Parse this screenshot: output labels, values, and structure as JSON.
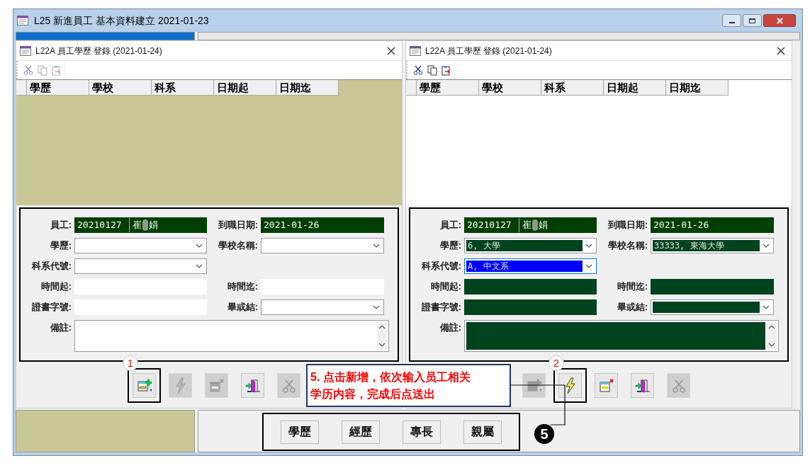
{
  "main_window": {
    "title": "L25 新進員工 基本資料建立  2021-01-23"
  },
  "dialogs": [
    {
      "title": "L22A 員工學歷 登錄 (2021-01-24)",
      "toolbar_enabled": false,
      "grid_active": false,
      "editing": false,
      "grid_columns": [
        "學歷",
        "學校",
        "科系",
        "日期起",
        "日期迄"
      ],
      "rows": [
        {
          "fields": [
            {
              "label": "員工:",
              "kind": "employee",
              "readonly": true,
              "focused": false,
              "values": [
                "20210127",
                "崔",
                "娟"
              ]
            },
            {
              "label": "到職日期:",
              "kind": "text",
              "readonly": true,
              "focused": false,
              "value": "2021-01-26"
            }
          ]
        },
        {
          "fields": [
            {
              "label": "學歷:",
              "kind": "combo",
              "readonly": false,
              "focused": false
            },
            {
              "label": "學校名稱:",
              "kind": "combo",
              "readonly": false,
              "focused": false
            }
          ]
        },
        {
          "fields": [
            {
              "label": "科系代號:",
              "kind": "combo",
              "readonly": false,
              "focused": false
            }
          ]
        },
        {
          "fields": [
            {
              "label": "時間起:",
              "kind": "text",
              "readonly": false,
              "focused": false
            },
            {
              "label": "時間迄:",
              "kind": "text",
              "readonly": false,
              "focused": false
            }
          ]
        },
        {
          "fields": [
            {
              "label": "證書字號:",
              "kind": "text",
              "readonly": false,
              "focused": false
            },
            {
              "label": "畢或結:",
              "kind": "combo",
              "readonly": false,
              "focused": false
            }
          ]
        },
        {
          "fields": [
            {
              "label": "備註:",
              "kind": "memo",
              "readonly": false,
              "focused": false
            }
          ]
        }
      ],
      "buttons": [
        {
          "kind": "add",
          "disabled": false,
          "marker": "1"
        },
        {
          "kind": "send",
          "disabled": true
        },
        {
          "kind": "delete",
          "disabled": true
        },
        {
          "kind": "exit",
          "disabled": false
        },
        {
          "kind": "cut",
          "disabled": true
        }
      ]
    },
    {
      "title": "L22A 員工學歷 登錄 (2021-01-24)",
      "toolbar_enabled": true,
      "grid_active": true,
      "editing": true,
      "grid_columns": [
        "學歷",
        "學校",
        "科系",
        "日期起",
        "日期迄"
      ],
      "rows": [
        {
          "fields": [
            {
              "label": "員工:",
              "kind": "employee",
              "readonly": true,
              "focused": false,
              "values": [
                "20210127",
                "崔",
                "娟"
              ]
            },
            {
              "label": "到職日期:",
              "kind": "text",
              "readonly": true,
              "focused": false,
              "value": "2021-01-26"
            }
          ]
        },
        {
          "fields": [
            {
              "label": "學歷:",
              "kind": "combo",
              "readonly": false,
              "focused": false,
              "value": "6, 大學"
            },
            {
              "label": "學校名稱:",
              "kind": "combo",
              "readonly": false,
              "focused": false,
              "value": "33333, 東海大學"
            }
          ]
        },
        {
          "fields": [
            {
              "label": "科系代號:",
              "kind": "combo",
              "readonly": false,
              "focused": true,
              "value": "A, 中文系"
            }
          ]
        },
        {
          "fields": [
            {
              "label": "時間起:",
              "kind": "text",
              "readonly": false,
              "focused": false
            },
            {
              "label": "時間迄:",
              "kind": "text",
              "readonly": false,
              "focused": false
            }
          ]
        },
        {
          "fields": [
            {
              "label": "證書字號:",
              "kind": "text",
              "readonly": false,
              "focused": false
            },
            {
              "label": "畢或結:",
              "kind": "combo",
              "readonly": false,
              "focused": false
            }
          ]
        },
        {
          "fields": [
            {
              "label": "備註:",
              "kind": "memo",
              "readonly": false,
              "focused": false
            }
          ]
        }
      ],
      "buttons": [
        {
          "kind": "add",
          "disabled": true
        },
        {
          "kind": "send",
          "disabled": false,
          "marker": "2"
        },
        {
          "kind": "delete",
          "disabled": false
        },
        {
          "kind": "exit",
          "disabled": false
        },
        {
          "kind": "cut",
          "disabled": true
        }
      ]
    }
  ],
  "bottom_tabs": [
    {
      "label": "學歷",
      "selected": false
    },
    {
      "label": "經歷",
      "selected": false
    },
    {
      "label": "專長",
      "selected": false
    },
    {
      "label": "親屬",
      "selected": false
    }
  ],
  "callout": {
    "lines": [
      "5. 点击新增，依次输入员工相关",
      "学历内容，完成后点送出"
    ],
    "step": "5"
  }
}
